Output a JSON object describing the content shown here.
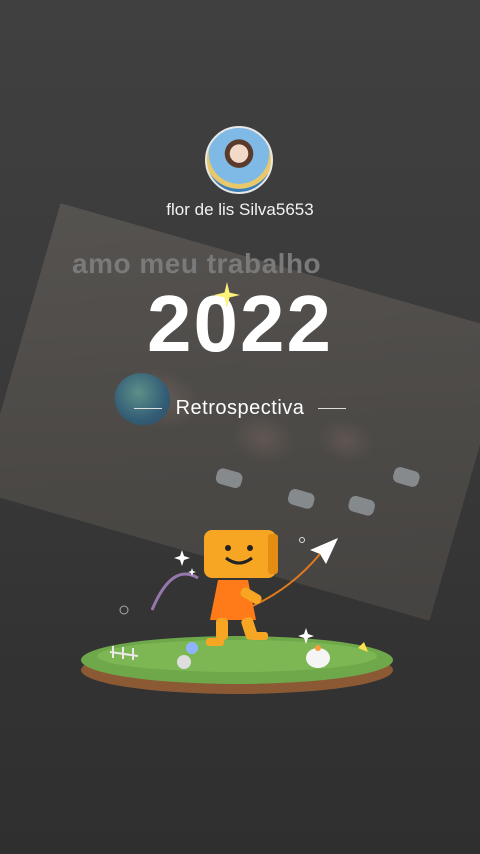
{
  "profile": {
    "username": "flor de lis Silva5653"
  },
  "overlay": {
    "caption": "amo meu trabalho",
    "year": "2022",
    "subtitle": "Retrospectiva"
  },
  "colors": {
    "background": "#3a3a3a",
    "caption": "#7a7a7a",
    "mascot": "#f6a623",
    "grass": "#6ea84a"
  },
  "icons": [
    "sparkle-icon",
    "paper-plane-icon",
    "mascot-icon"
  ]
}
